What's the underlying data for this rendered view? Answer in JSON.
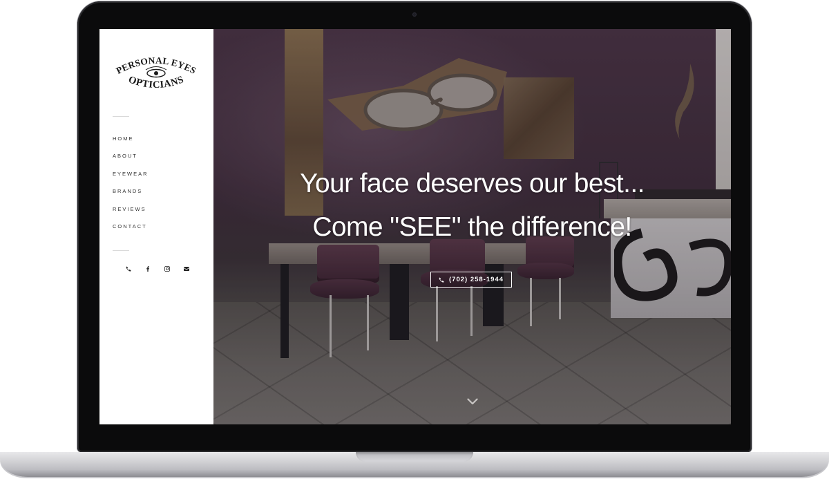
{
  "brand": {
    "logo_line1": "PERSONAL EYES",
    "logo_line2": "OPTICIANS"
  },
  "nav": {
    "items": [
      {
        "label": "HOME"
      },
      {
        "label": "ABOUT"
      },
      {
        "label": "EYEWEAR"
      },
      {
        "label": "BRANDS"
      },
      {
        "label": "REVIEWS"
      },
      {
        "label": "CONTACT"
      }
    ]
  },
  "social": {
    "icons": [
      "phone-icon",
      "facebook-icon",
      "instagram-icon",
      "email-icon"
    ]
  },
  "hero": {
    "headline_line1": "Your face deserves our best...",
    "headline_line2": "Come \"SEE\" the difference!",
    "phone_button_label": "(702) 258-1944",
    "scroll_icon": "chevron-down-icon"
  },
  "colors": {
    "sidebar_bg": "#ffffff",
    "nav_text": "#333333",
    "hero_text": "#ffffff",
    "laptop_bezel": "#0b0b0c"
  }
}
